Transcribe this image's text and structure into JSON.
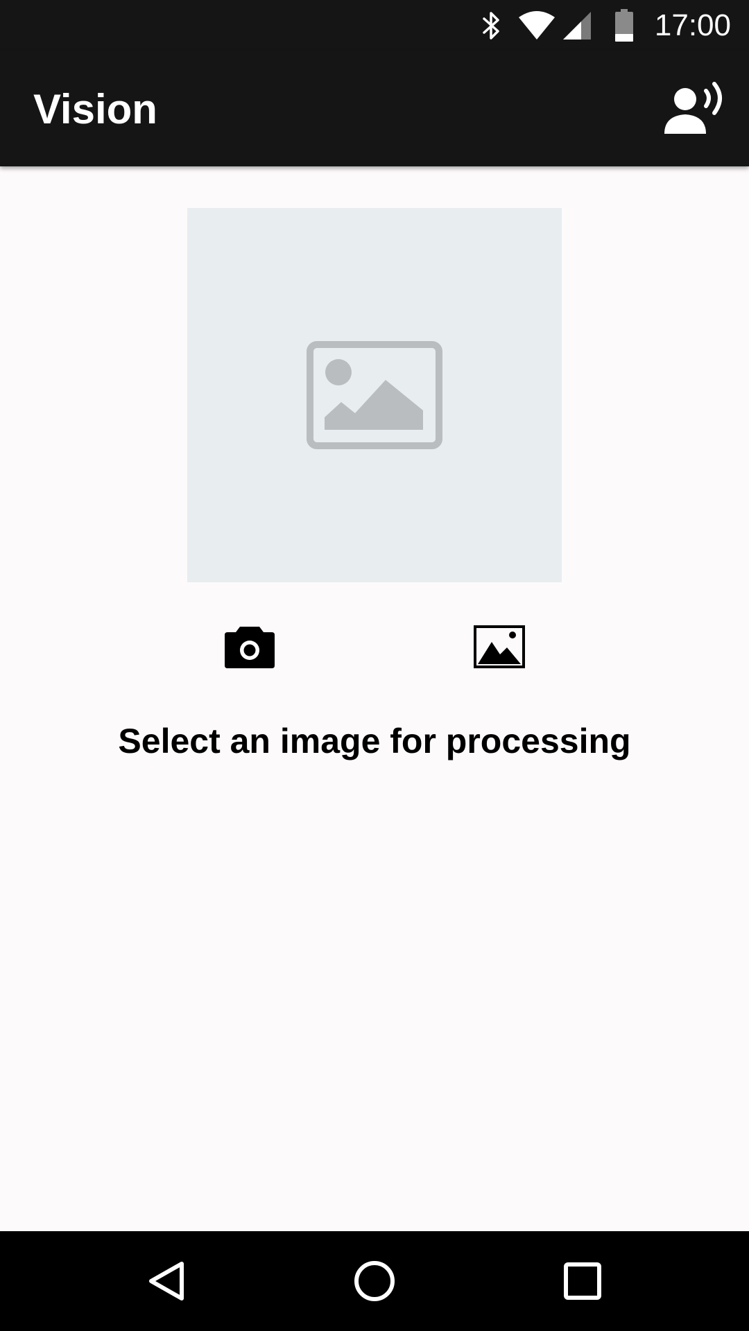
{
  "status_bar": {
    "time": "17:00",
    "icons": [
      "bluetooth-icon",
      "wifi-icon",
      "cell-signal-icon",
      "battery-icon"
    ]
  },
  "app_bar": {
    "title": "Vision",
    "action_icon": "record-voice-icon"
  },
  "main": {
    "image_placeholder_icon": "image-placeholder-icon",
    "actions": [
      {
        "icon": "camera-icon"
      },
      {
        "icon": "photo-gallery-icon"
      }
    ],
    "prompt": "Select an image for processing"
  },
  "nav_bar": {
    "buttons": [
      "back-icon",
      "home-icon",
      "recents-icon"
    ]
  },
  "colors": {
    "bar_background": "#151515",
    "page_background": "#fdfafb",
    "placeholder_background": "#e8edf0",
    "placeholder_icon": "#babdbf",
    "nav_background": "#000000"
  }
}
